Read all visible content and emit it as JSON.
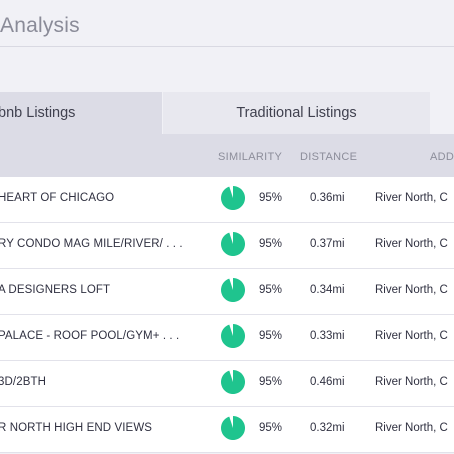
{
  "page": {
    "title": "Analysis"
  },
  "tabs": [
    {
      "label": "Airbnb Listings",
      "visible_text": "irbnb Listings",
      "active": true
    },
    {
      "label": "Traditional Listings",
      "active": false
    }
  ],
  "table": {
    "columns": [
      "SIMILARITY",
      "DISTANCE",
      "ADD"
    ],
    "rows": [
      {
        "name": "HEART OF CHICAGO",
        "similarity": "95%",
        "similarity_value": 0.95,
        "distance": "0.36mi",
        "address": "River North, C"
      },
      {
        "name": "RY CONDO MAG MILE/RIVER/ . . .",
        "similarity": "95%",
        "similarity_value": 0.95,
        "distance": "0.37mi",
        "address": "River North, C"
      },
      {
        "name": "A DESIGNERS LOFT",
        "similarity": "95%",
        "similarity_value": 0.95,
        "distance": "0.34mi",
        "address": "River North, C"
      },
      {
        "name": "PALACE - ROOF POOL/GYM+ . . .",
        "similarity": "95%",
        "similarity_value": 0.95,
        "distance": "0.33mi",
        "address": "River North, C"
      },
      {
        "name": "3D/2BTH",
        "similarity": "95%",
        "similarity_value": 0.95,
        "distance": "0.46mi",
        "address": "River North, C"
      },
      {
        "name": "R NORTH HIGH END VIEWS",
        "similarity": "95%",
        "similarity_value": 0.95,
        "distance": "0.32mi",
        "address": "River North, C"
      }
    ]
  },
  "colors": {
    "accent_green": "#1fc48e",
    "pie_background": "#ffffff"
  }
}
